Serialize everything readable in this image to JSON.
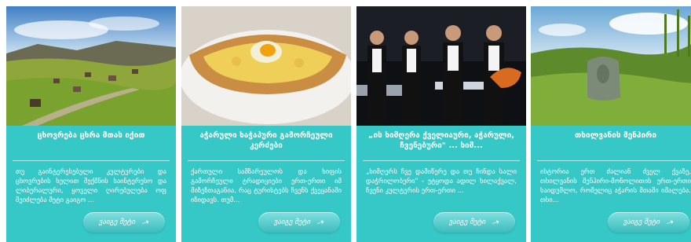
{
  "cards": [
    {
      "title": "ცხოვრება ცხრა მთას იქით",
      "description": "თუ გაინტერესებული კულტურები და ცხოვრების ხელით შექმნის საინტერესო და ლიბერალური, ყოველი ღირებულება ოფ შეიძლება მეტი გაიგო ...",
      "more_label": "ვაიგე მეტი",
      "image": "mountain-village-landscape"
    },
    {
      "title": "აჭარული ხაჭაპური გამორჩეული კერძები",
      "description": "ქართული სამზარეულოს და ხიფის გამორჩეული ტრადიციები ერთ-ერთი იმ მიზეზთაგანია, რაც ტურისტებს ჩვენს ქვეყანაში იზიდავს. თუმ...",
      "more_label": "ვაიგე მეტი",
      "image": "adjarian-khachapuri-photo"
    },
    {
      "title": "„ის ხიმღერა ქველიაური, აჭარული, ჩვენებური\" ... ხიმ...",
      "description": "„ხიმღერს ჩვე დამიწერე და თუ ჩინდა სალი დაჭრილობერი\" - ეტყოდა ადილ ხილაქვალ, ჩვენი კულტურის ერთ-ერთი ...",
      "more_label": "ვაიგე მეტი",
      "image": "folk-ensemble-performance"
    },
    {
      "title": "თხილვანის მენჰირი",
      "description": "ისტორია ერთ ძალიან ძველ ქვაზე, თხილვანის მენჰირი-მონოლითის ერთ-ერთი საიდუმლო, რომელიც აჭარის მთაში იმალება. თხი...",
      "more_label": "ვაიგე მეტი",
      "image": "menhir-green-hillside"
    }
  ],
  "colors": {
    "card_background": "#36c7c7",
    "button_gradient_top": "#7fe0e0",
    "button_gradient_bottom": "#3cbcbc",
    "text": "#ffffff"
  }
}
